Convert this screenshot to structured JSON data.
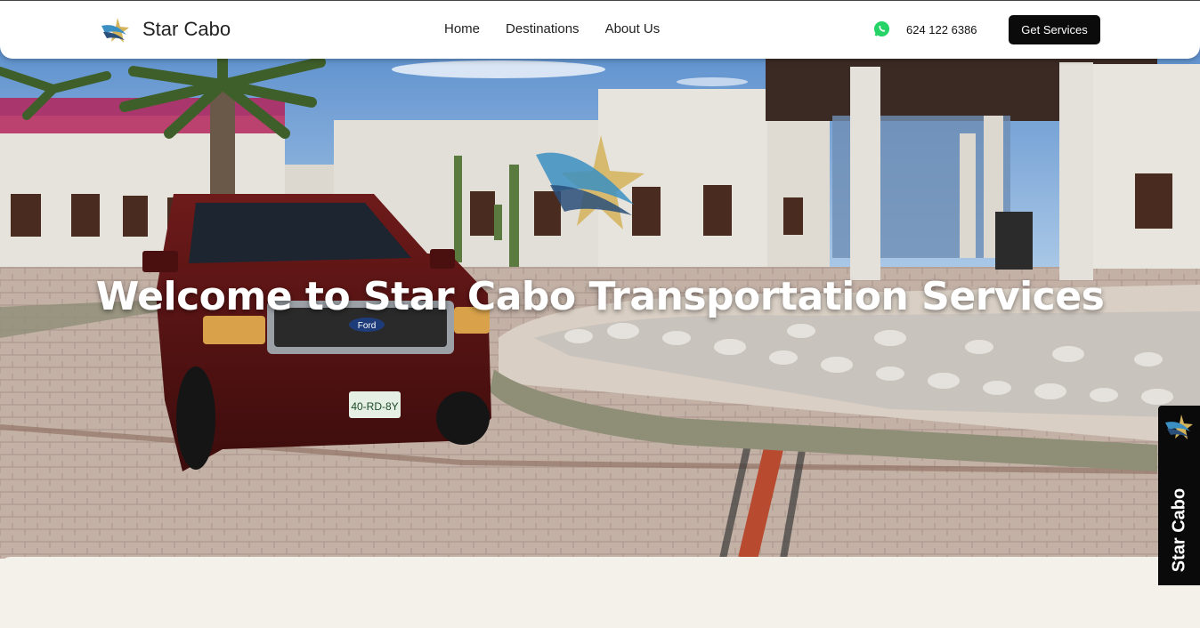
{
  "header": {
    "brand": "Star Cabo",
    "nav": [
      "Home",
      "Destinations",
      "About Us"
    ],
    "phone": "624 122 6386",
    "cta_label": "Get Services",
    "phone_icon": "whatsapp-icon",
    "logo_icon": "star-logo-icon"
  },
  "hero": {
    "title": "Welcome to Star Cabo Transportation Services",
    "license_plate": "40-RD-8Y",
    "car_badge": "Ford"
  },
  "side_tab": {
    "label": "Star Cabo"
  },
  "colors": {
    "header_bg": "#ffffff",
    "cta_bg": "#0b0b0b",
    "whatsapp": "#25d366",
    "lower_bg": "#f3f1ea",
    "car": "#5a1414"
  }
}
